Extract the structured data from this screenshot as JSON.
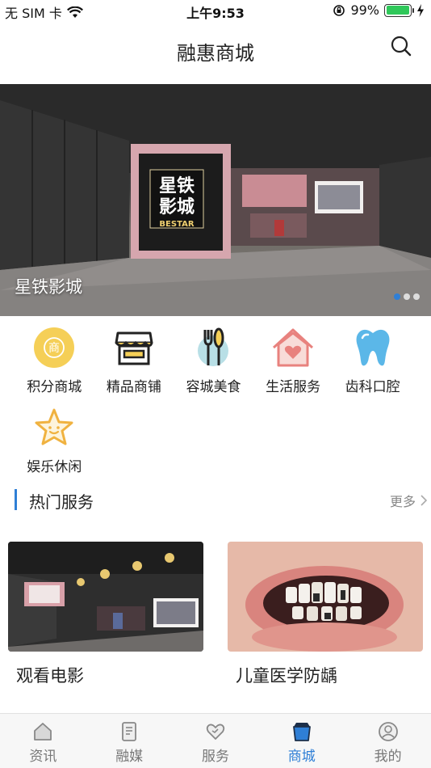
{
  "status_bar": {
    "carrier": "无 SIM 卡",
    "time": "上午9:53",
    "battery_percent": "99%",
    "battery_level": 0.99
  },
  "nav": {
    "title": "融惠商城",
    "search_icon": "search-icon"
  },
  "banner": {
    "caption": "星铁影城",
    "slide_count": 3,
    "active_slide": 0,
    "sign_text": [
      "星铁",
      "影城",
      "BESTAR"
    ]
  },
  "categories": [
    {
      "label": "积分商城",
      "icon": "points-mall-icon",
      "badge": "商"
    },
    {
      "label": "精品商铺",
      "icon": "shop-icon"
    },
    {
      "label": "容城美食",
      "icon": "food-icon"
    },
    {
      "label": "生活服务",
      "icon": "life-service-icon"
    },
    {
      "label": "齿科口腔",
      "icon": "tooth-icon"
    },
    {
      "label": "娱乐休闲",
      "icon": "star-icon"
    }
  ],
  "hot_section": {
    "title": "热门服务",
    "more": "更多"
  },
  "cards": [
    {
      "title": "观看电影",
      "image": "cinema-interior-image"
    },
    {
      "title": "儿童医学防龋",
      "image": "child-teeth-image"
    }
  ],
  "tabs": [
    {
      "label": "资讯",
      "icon": "home-icon",
      "active": false
    },
    {
      "label": "融媒",
      "icon": "document-icon",
      "active": false
    },
    {
      "label": "服务",
      "icon": "heart-icon",
      "active": false
    },
    {
      "label": "商城",
      "icon": "bag-icon",
      "active": true
    },
    {
      "label": "我的",
      "icon": "profile-icon",
      "active": false
    }
  ],
  "colors": {
    "accent": "#2f7fd6",
    "gold": "#f0c040",
    "pink": "#e8827e",
    "tooth_blue": "#5bb7e8"
  }
}
